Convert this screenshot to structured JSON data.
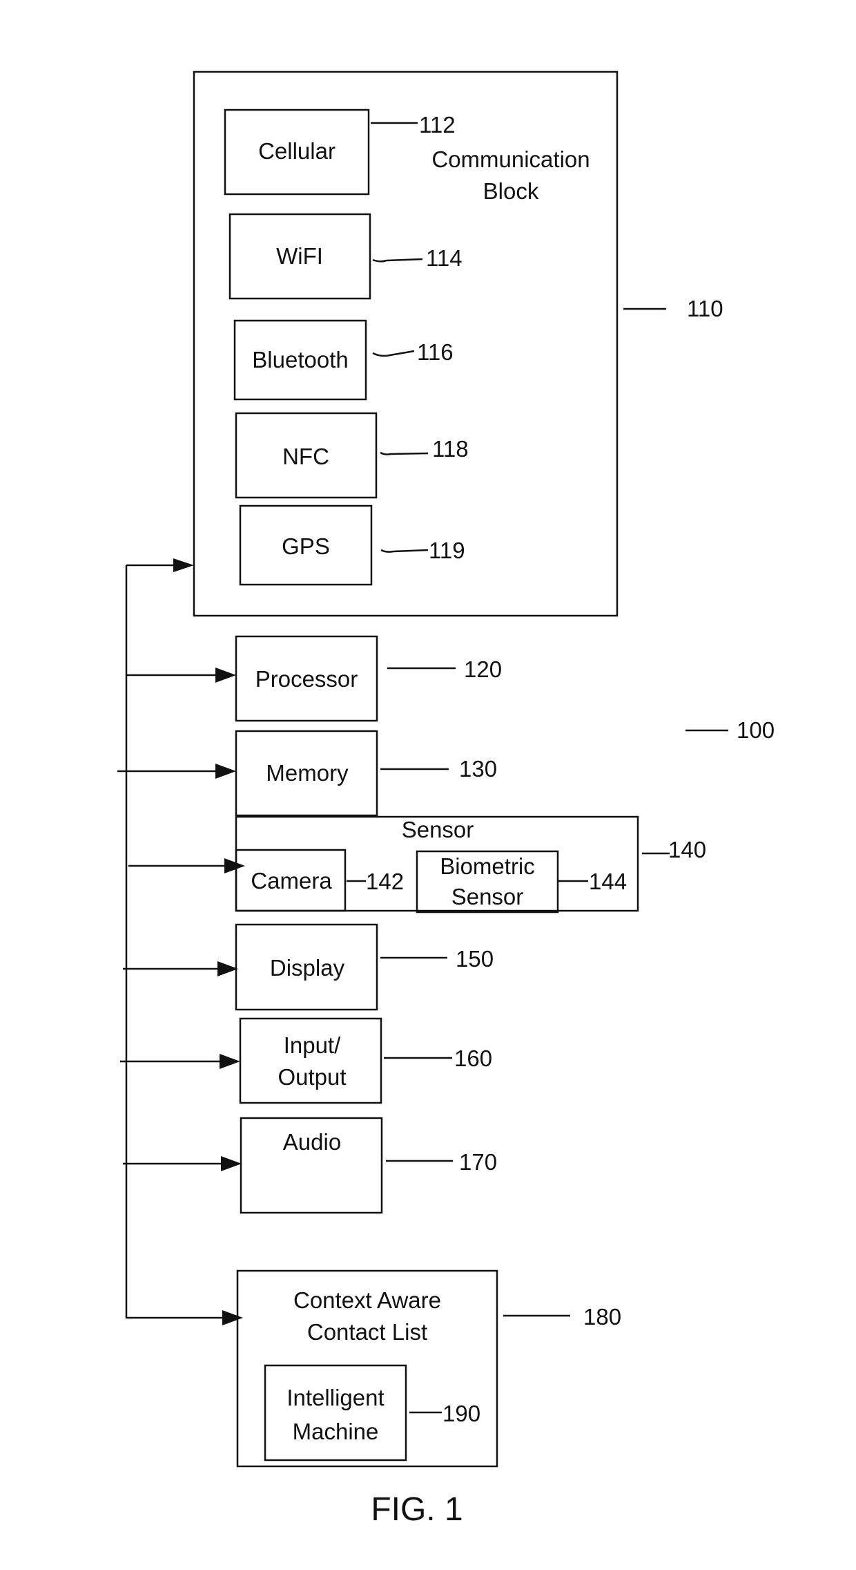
{
  "figure_label": "FIG. 1",
  "system_ref": "100",
  "communication_block": {
    "title_line1": "Communication",
    "title_line2": "Block",
    "ref": "110",
    "modules": [
      {
        "label": "Cellular",
        "ref": "112"
      },
      {
        "label": "WiFI",
        "ref": "114"
      },
      {
        "label": "Bluetooth",
        "ref": "116"
      },
      {
        "label": "NFC",
        "ref": "118"
      },
      {
        "label": "GPS",
        "ref": "119"
      }
    ]
  },
  "components": {
    "processor": {
      "label": "Processor",
      "ref": "120"
    },
    "memory": {
      "label": "Memory",
      "ref": "130"
    },
    "sensor": {
      "label": "Sensor",
      "ref": "140",
      "camera": {
        "label": "Camera",
        "ref": "142"
      },
      "biometric": {
        "label_line1": "Biometric",
        "label_line2": "Sensor",
        "ref": "144"
      }
    },
    "display": {
      "label": "Display",
      "ref": "150"
    },
    "io": {
      "label_line1": "Input/",
      "label_line2": "Output",
      "ref": "160"
    },
    "audio": {
      "label": "Audio",
      "ref": "170"
    },
    "contact_list": {
      "label_line1": "Context Aware",
      "label_line2": "Contact List",
      "ref": "180",
      "intelligent_machine": {
        "label_line1": "Intelligent",
        "label_line2": "Machine",
        "ref": "190"
      }
    }
  }
}
